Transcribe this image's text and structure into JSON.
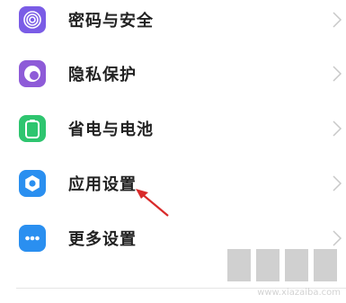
{
  "settings": {
    "items": [
      {
        "label": "密码与安全",
        "icon": "fingerprint-icon",
        "color": "#7a5ce6"
      },
      {
        "label": "隐私保护",
        "icon": "privacy-eye-icon",
        "color": "#8e5bd8"
      },
      {
        "label": "省电与电池",
        "icon": "battery-icon",
        "color": "#2ec56f"
      },
      {
        "label": "应用设置",
        "icon": "app-gear-icon",
        "color": "#2a8ff0"
      },
      {
        "label": "更多设置",
        "icon": "more-dots-icon",
        "color": "#2a8ff0"
      }
    ]
  },
  "annotation": {
    "type": "red-arrow",
    "target": "应用设置",
    "color": "#d92a2a"
  },
  "watermark": {
    "text": "www.xiazaiba.com"
  }
}
